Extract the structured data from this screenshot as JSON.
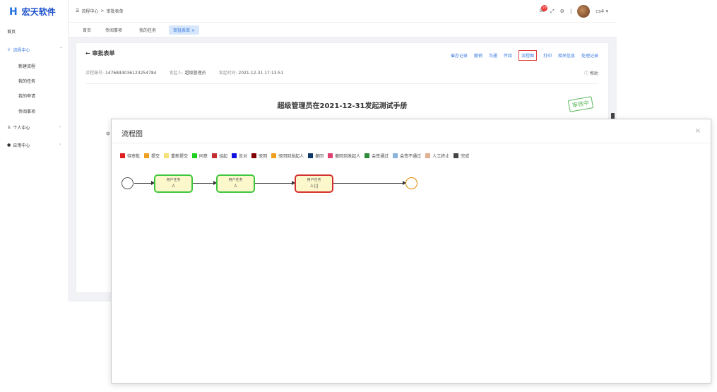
{
  "brand": {
    "name": "宏天软件",
    "mark": "H"
  },
  "sidebar": {
    "home": "首页",
    "process_center": "流程中心",
    "items": [
      "新建流程",
      "我的任务",
      "我的申请",
      "传阅事项"
    ],
    "personal_center": "个人中心",
    "app_center": "应用中心"
  },
  "breadcrumb": {
    "root": "流程中心",
    "sep": ">",
    "current": "审批表单"
  },
  "topbar": {
    "badge_count": "10",
    "user": "cs4 ▾",
    "divider": "|"
  },
  "tabs": [
    "首页",
    "传阅事项",
    "我的任务",
    "审批表单 ×"
  ],
  "card": {
    "back_title": "← 审批表单",
    "actions": [
      "催办记录",
      "撤销",
      "沟通",
      "传阅",
      "流程图",
      "打印",
      "相关信息",
      "处理记录"
    ],
    "meta": {
      "flow_no_label": "流程编号:",
      "flow_no": "1476844036123254784",
      "initiator_label": "发起人:",
      "initiator": "超级管理员",
      "time_label": "发起时间:",
      "time": "2021-12-31 17:13:51"
    },
    "help": "帮助",
    "doc_title": "超级管理员在2021-12-31发起测试手册",
    "stamp": "审核中",
    "peek": "申"
  },
  "modal": {
    "title": "流程图",
    "close": "×",
    "legend": [
      {
        "label": "待审批",
        "color": "#e02020"
      },
      {
        "label": "提交",
        "color": "#f0a020"
      },
      {
        "label": "重新提交",
        "color": "#f5e07a"
      },
      {
        "label": "同意",
        "color": "#20d020"
      },
      {
        "label": "挂起",
        "color": "#c03030"
      },
      {
        "label": "反对",
        "color": "#1010e0"
      },
      {
        "label": "驳回",
        "color": "#800000"
      },
      {
        "label": "驳回到发起人",
        "color": "#f0a020"
      },
      {
        "label": "撤回",
        "color": "#0d3a6a"
      },
      {
        "label": "撤回到发起人",
        "color": "#e04070"
      },
      {
        "label": "会签通过",
        "color": "#2e8b3a"
      },
      {
        "label": "会签不通过",
        "color": "#8ab4dc"
      },
      {
        "label": "人工终止",
        "color": "#e0b090"
      },
      {
        "label": "完成",
        "color": "#444444"
      }
    ],
    "tasks": [
      {
        "label": "用户任务",
        "icon": "♙"
      },
      {
        "label": "用户任务",
        "icon": "♙"
      },
      {
        "label": "用户任务",
        "icon": "♙|||"
      }
    ]
  }
}
